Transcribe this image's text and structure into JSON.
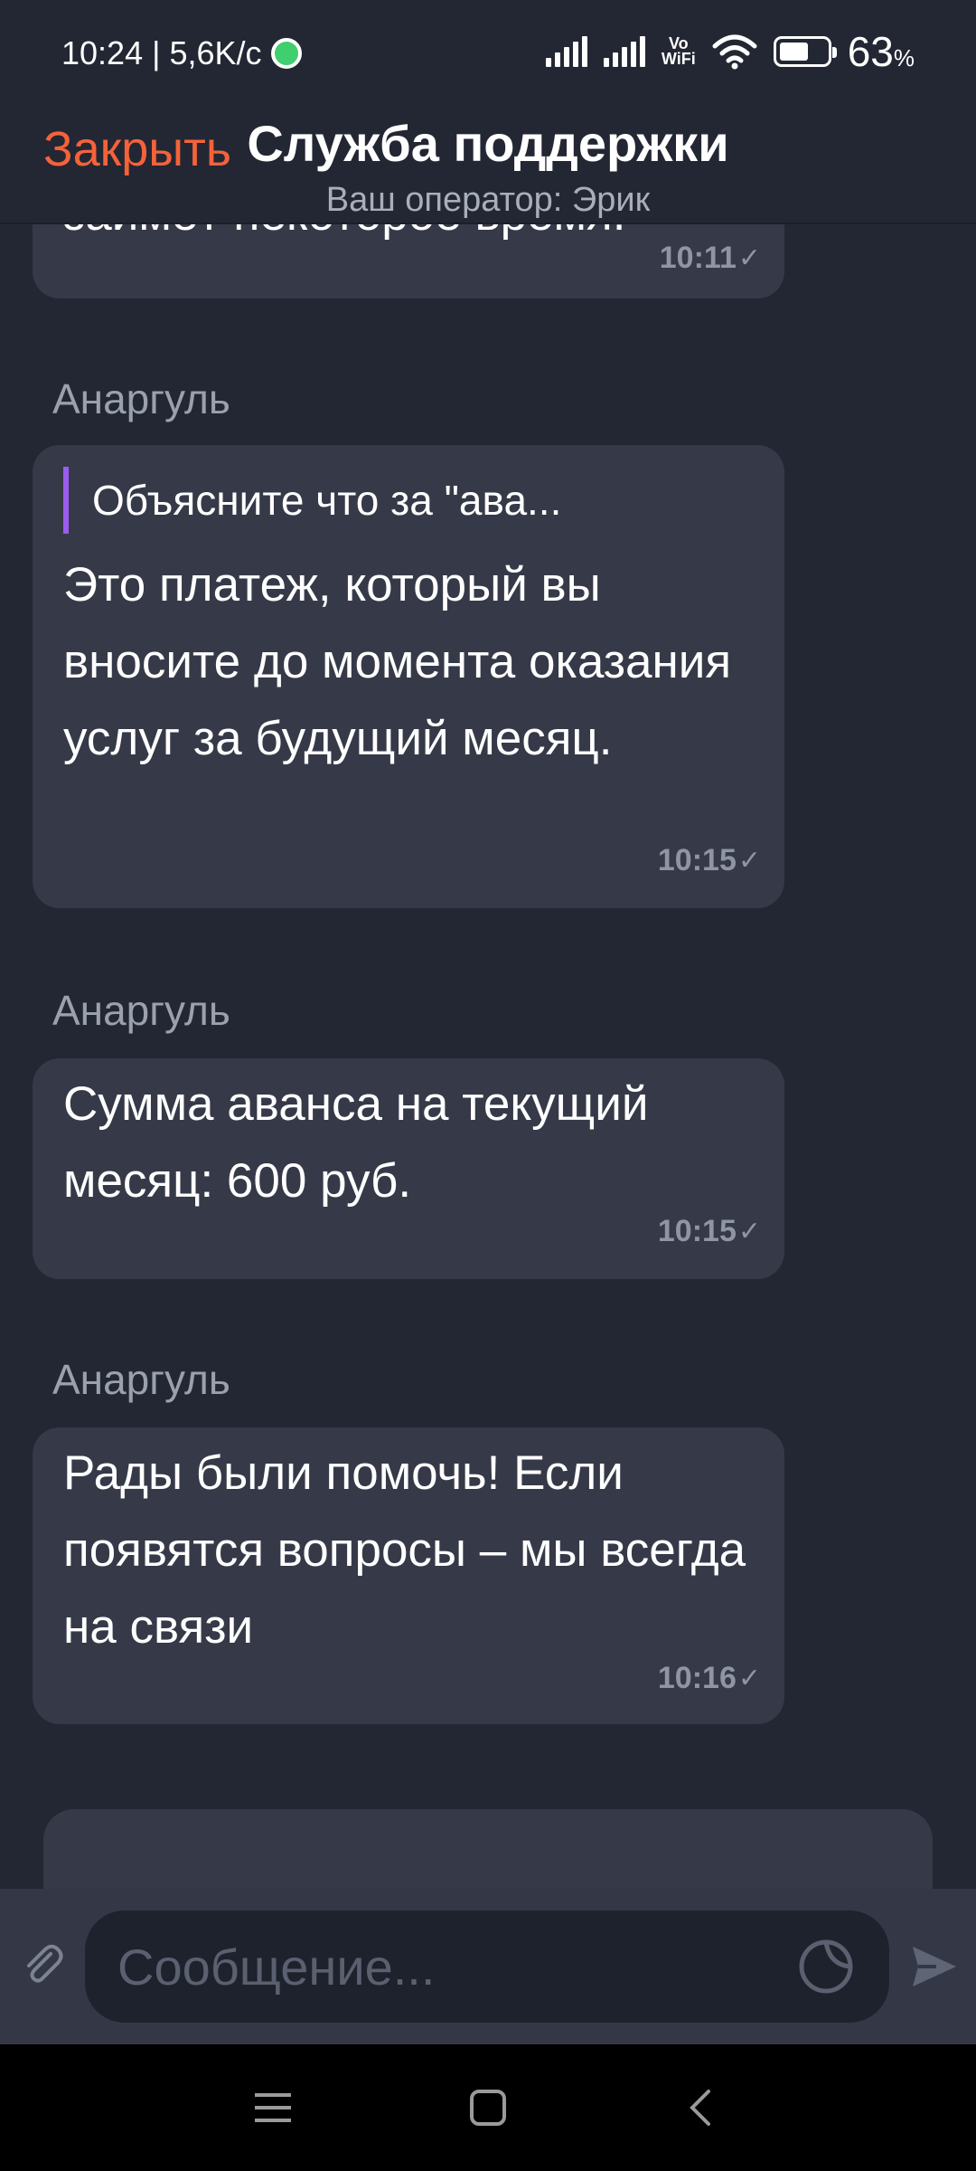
{
  "status_bar": {
    "time_speed": "10:24 | 5,6K/c",
    "vowifi_top": "Vo",
    "vowifi_bottom": "WiFi",
    "battery_level": 63,
    "battery_value": "63",
    "battery_unit": "%"
  },
  "header": {
    "close_label": "Закрыть",
    "title": "Служба поддержки",
    "subtitle": "Ваш оператор: Эрик"
  },
  "messages": [
    {
      "partial_text": "займёт некоторое время.",
      "time": "10:11"
    },
    {
      "sender": "Анаргуль",
      "quote": "Объясните что за \"ава...",
      "text": "Это платеж, который вы вносите до момента оказания услуг за будущий месяц.",
      "time": "10:15"
    },
    {
      "sender": "Анаргуль",
      "text": "Сумма аванса на текущий месяц: 600 руб.",
      "time": "10:15"
    },
    {
      "sender": "Анаргуль",
      "text": "Рады были помочь! Если появятся вопросы – мы всегда на связи",
      "time": "10:16"
    }
  ],
  "check_mark": "✓",
  "composer": {
    "placeholder": "Сообщение..."
  },
  "colors": {
    "accent": "#f5623a",
    "quote_bar": "#9b5cf0",
    "background": "#222733",
    "bubble": "#363a48"
  }
}
